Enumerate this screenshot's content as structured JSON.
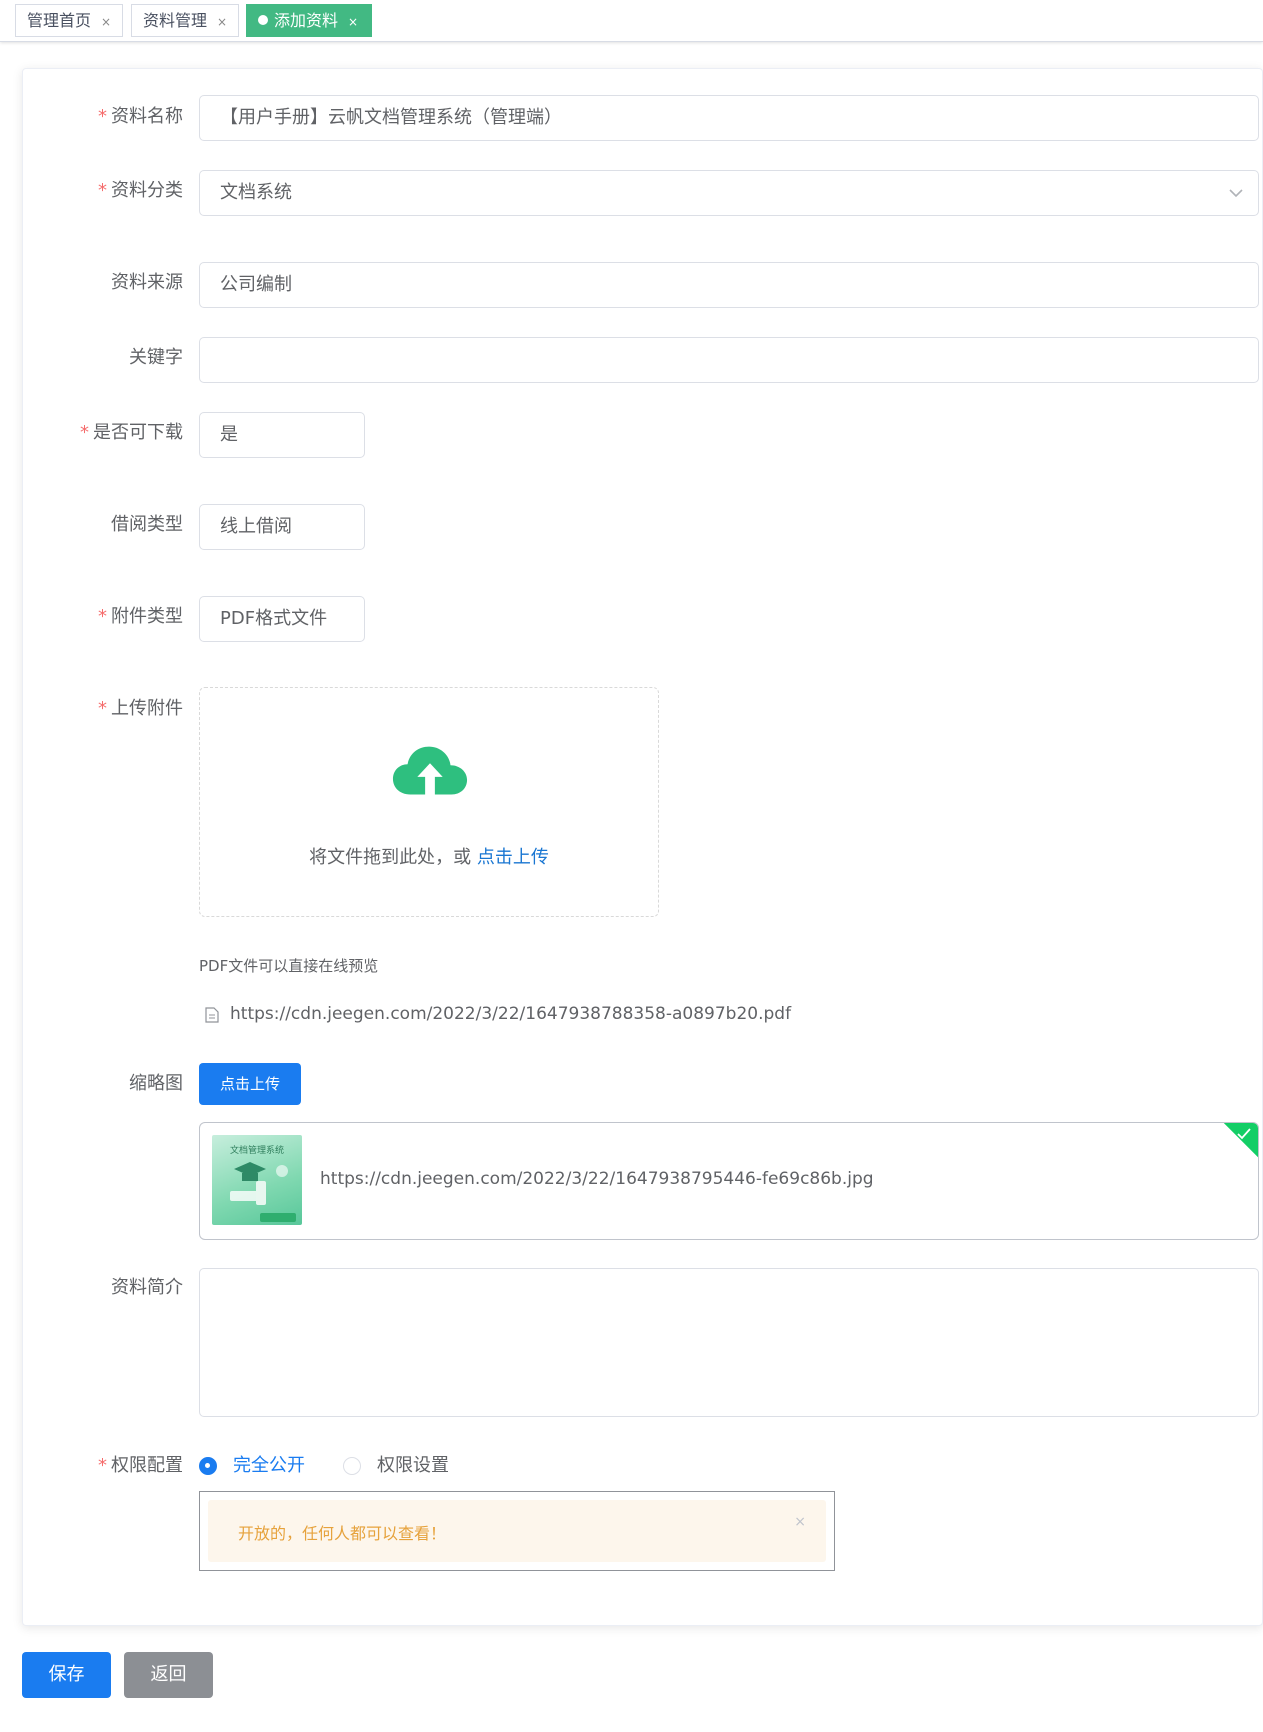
{
  "tabs": [
    {
      "label": "管理首页",
      "close": "×",
      "active": false
    },
    {
      "label": "资料管理",
      "close": "×",
      "active": false
    },
    {
      "label": "添加资料",
      "close": "×",
      "active": true
    }
  ],
  "form": {
    "name": {
      "label": "资料名称",
      "required": "*",
      "value": "【用户手册】云帆文档管理系统（管理端）"
    },
    "category": {
      "label": "资料分类",
      "required": "*",
      "value": "文档系统"
    },
    "source": {
      "label": "资料来源",
      "value": "公司编制"
    },
    "keyword": {
      "label": "关键字",
      "value": ""
    },
    "downloadable": {
      "label": "是否可下载",
      "required": "*",
      "value": "是"
    },
    "borrow_type": {
      "label": "借阅类型",
      "value": "线上借阅"
    },
    "attach_type": {
      "label": "附件类型",
      "required": "*",
      "value": "PDF格式文件"
    },
    "upload": {
      "label": "上传附件",
      "required": "*",
      "drag_text": "将文件拖到此处，或",
      "click_text": "点击上传",
      "tip": "PDF文件可以直接在线预览",
      "file_url": "https://cdn.jeegen.com/2022/3/22/1647938788358-a0897b20.pdf"
    },
    "thumbnail": {
      "label": "缩略图",
      "button": "点击上传",
      "image_title": "文档管理系统",
      "file_url": "https://cdn.jeegen.com/2022/3/22/1647938795446-fe69c86b.jpg"
    },
    "intro": {
      "label": "资料简介",
      "value": ""
    },
    "permission": {
      "label": "权限配置",
      "required": "*",
      "options": [
        "完全公开",
        "权限设置"
      ],
      "selected": "完全公开",
      "alert": "开放的，任何人都可以查看！",
      "alert_close": "×"
    }
  },
  "actions": {
    "save": "保存",
    "back": "返回"
  },
  "colors": {
    "brand_green": "#42b983",
    "primary_blue": "#1a7cf0",
    "required_red": "#f56c6c",
    "warning_text": "#e6a23c",
    "upload_icon": "#2ebf7f"
  }
}
